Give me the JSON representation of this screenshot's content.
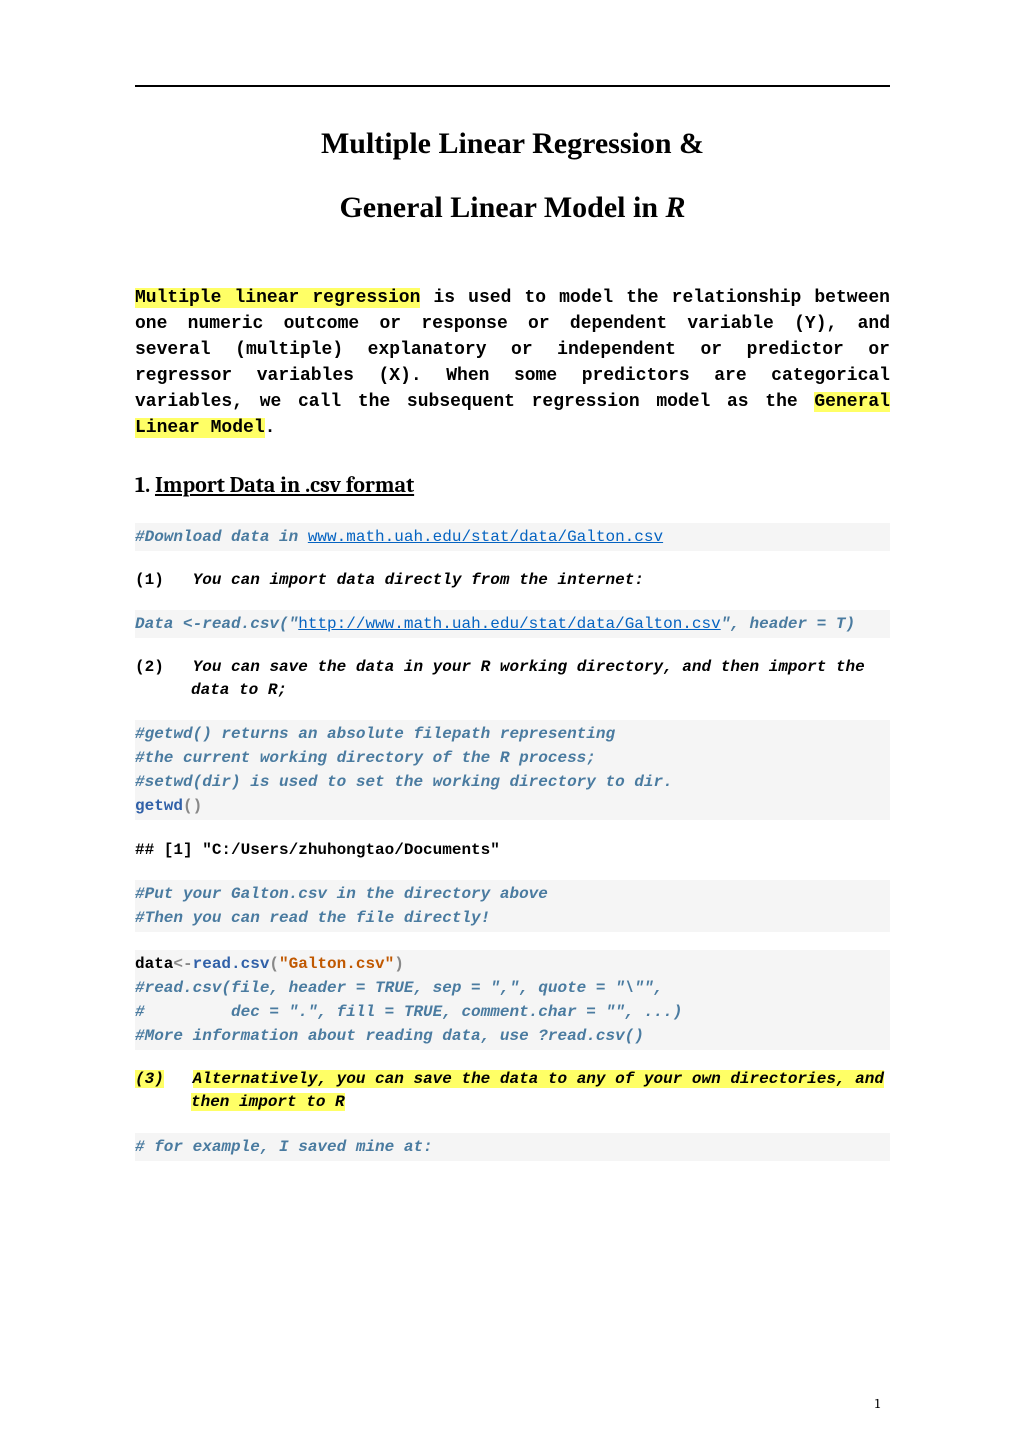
{
  "title1": "Multiple Linear Regression &",
  "title2_a": "General Linear Model in ",
  "title2_b": "R",
  "intro": {
    "hl1": "Multiple linear regression",
    "t1": " is used to model the relationship between one numeric outcome or response or dependent variable (Y), and several (multiple) explanatory or independent or predictor or regressor variables (X). When some predictors are categorical variables, we call the subsequent regression model as the ",
    "hl2": "General Linear Model",
    "t2": "."
  },
  "section1": {
    "num": "1.",
    "title": "Import Data in .csv format"
  },
  "c1a": "#Download data in ",
  "c1b": "www.math.uah.edu/stat/data/Galton.csv",
  "step1": {
    "num": "(1)",
    "text": "You can import data directly from the internet:"
  },
  "c2a": "Data <-read.csv(\"",
  "c2b": "http://www.math.uah.edu/stat/data/Galton.csv",
  "c2c": "\", header = T)",
  "step2": {
    "num": "(2)",
    "text": "You can save the data in your R working directory, and then import the data to R;"
  },
  "c3a": "#getwd() returns an absolute filepath representing",
  "c3b": "#the current working directory of the R process;",
  "c3c": "#setwd(dir) is used to set the working directory to dir.",
  "c3d_kw": "getwd",
  "c3d_paren": "()",
  "out1": "## [1] \"C:/Users/zhuhongtao/Documents\"",
  "c4a": "#Put your Galton.csv in the directory above",
  "c4b": "#Then you can read the file directly!",
  "c5": {
    "a": "data",
    "b": "<-",
    "c": "read.csv",
    "d": "(",
    "e": "\"Galton.csv\"",
    "f": ")"
  },
  "c6a": "#read.csv(file, header = TRUE, sep = \",\", quote = \"\\\"\",",
  "c6b": "#         dec = \".\", fill = TRUE, comment.char = \"\", ...)",
  "c6c": "#More information about reading data, use ?read.csv()",
  "step3": {
    "num": "(3)",
    "text": "Alternatively, you can save the data to any of your own directories, and then import to R"
  },
  "c7": "# for example, I saved mine at:",
  "pageno": "1"
}
